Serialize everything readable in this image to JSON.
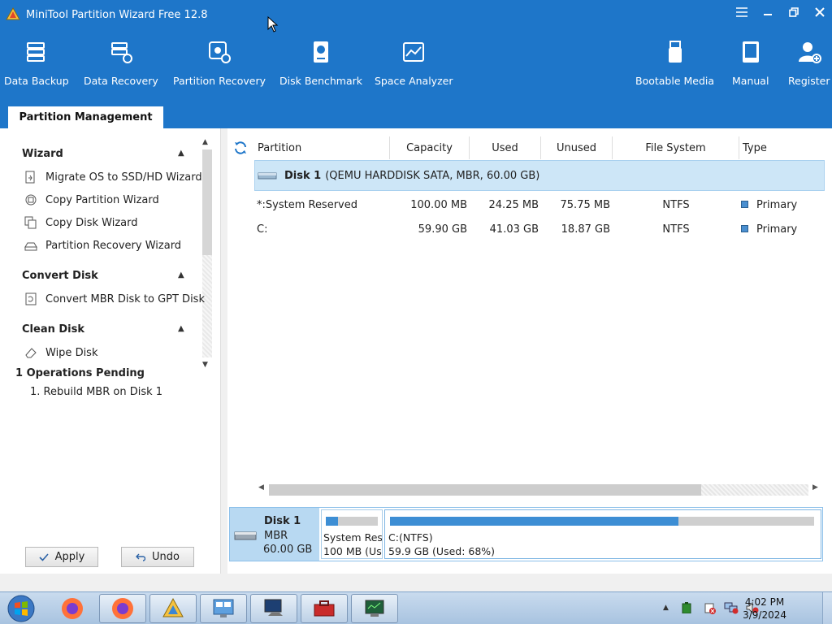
{
  "app": {
    "title": "MiniTool Partition Wizard Free 12.8"
  },
  "toolbar": {
    "data_backup": "Data Backup",
    "data_recovery": "Data Recovery",
    "partition_recovery": "Partition Recovery",
    "disk_benchmark": "Disk Benchmark",
    "space_analyzer": "Space Analyzer",
    "bootable_media": "Bootable Media",
    "manual": "Manual",
    "register": "Register"
  },
  "tabs": {
    "partition_management": "Partition Management"
  },
  "sidebar": {
    "wizard": {
      "title": "Wizard",
      "items": [
        "Migrate OS to SSD/HD Wizard",
        "Copy Partition Wizard",
        "Copy Disk Wizard",
        "Partition Recovery Wizard"
      ]
    },
    "convert_disk": {
      "title": "Convert Disk",
      "items": [
        "Convert MBR Disk to GPT Disk"
      ]
    },
    "clean_disk": {
      "title": "Clean Disk",
      "items": [
        "Wipe Disk"
      ]
    },
    "operations": {
      "title": "1 Operations Pending",
      "items": [
        "1. Rebuild MBR on Disk 1"
      ]
    },
    "apply": "Apply",
    "undo": "Undo"
  },
  "table": {
    "columns": [
      "Partition",
      "Capacity",
      "Used",
      "Unused",
      "File System",
      "Type"
    ],
    "disk": {
      "name": "Disk 1",
      "desc": "(QEMU HARDDISK SATA, MBR, 60.00 GB)"
    },
    "rows": [
      {
        "partition": "*:System Reserved",
        "capacity": "100.00 MB",
        "used": "24.25 MB",
        "unused": "75.75 MB",
        "fs": "NTFS",
        "type": "Primary"
      },
      {
        "partition": "C:",
        "capacity": "59.90 GB",
        "used": "41.03 GB",
        "unused": "18.87 GB",
        "fs": "NTFS",
        "type": "Primary"
      }
    ]
  },
  "diskmap": {
    "disk_name": "Disk 1",
    "disk_style": "MBR",
    "disk_size": "60.00 GB",
    "p1_label": "System Rese",
    "p1_info": "100 MB (Use",
    "p1_used_fraction": 0.24,
    "p2_label": "C:(NTFS)",
    "p2_info": "59.9 GB (Used: 68%)",
    "p2_used_fraction": 0.68
  },
  "taskbar": {
    "time": "4:02 PM",
    "date": "3/9/2024"
  },
  "colors": {
    "accent": "#1e76c9",
    "selected_row": "#cde6f7",
    "used_bar": "#3d8ed4"
  }
}
